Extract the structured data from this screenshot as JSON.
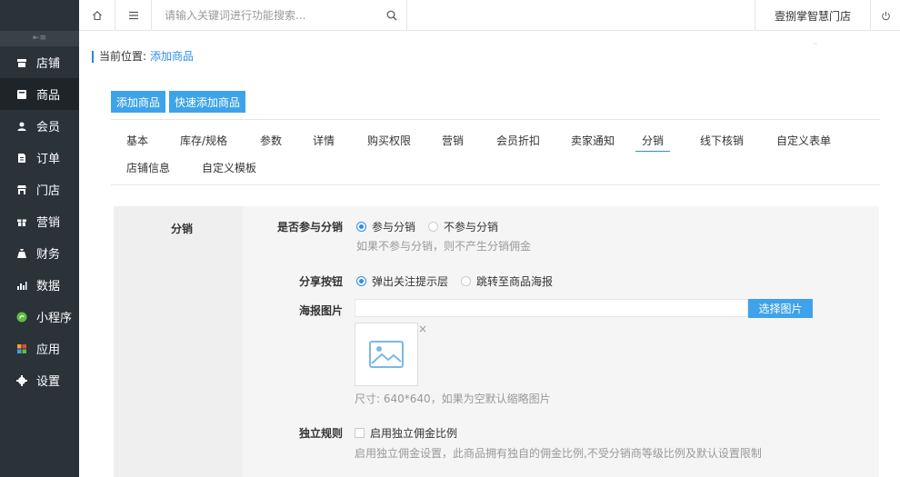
{
  "sidebar": {
    "collapse_icon": "collapse-icon",
    "items": [
      {
        "label": "店铺",
        "icon": "store-icon",
        "active": false
      },
      {
        "label": "商品",
        "icon": "goods-icon",
        "active": true
      },
      {
        "label": "会员",
        "icon": "member-icon",
        "active": false
      },
      {
        "label": "订单",
        "icon": "order-icon",
        "active": false
      },
      {
        "label": "门店",
        "icon": "shop-icon",
        "active": false
      },
      {
        "label": "营销",
        "icon": "gift-icon",
        "active": false
      },
      {
        "label": "财务",
        "icon": "finance-icon",
        "active": false
      },
      {
        "label": "数据",
        "icon": "chart-icon",
        "active": false
      },
      {
        "label": "小程序",
        "icon": "miniapp-icon",
        "active": false
      },
      {
        "label": "应用",
        "icon": "apps-icon",
        "active": false
      },
      {
        "label": "设置",
        "icon": "gear-icon",
        "active": false
      }
    ]
  },
  "topbar": {
    "search_placeholder": "请输入关键词进行功能搜索...",
    "store_name": "壹捌掌智慧门店"
  },
  "breadcrumb": {
    "label": "当前位置:",
    "current": "添加商品"
  },
  "buttons": {
    "add": "添加商品",
    "quick_add": "快速添加商品"
  },
  "tabs": [
    {
      "label": "基本"
    },
    {
      "label": "库存/规格"
    },
    {
      "label": "参数"
    },
    {
      "label": "详情"
    },
    {
      "label": "购买权限"
    },
    {
      "label": "营销"
    },
    {
      "label": "会员折扣"
    },
    {
      "label": "卖家通知"
    },
    {
      "label": "分销",
      "active": true
    },
    {
      "label": "线下核销"
    },
    {
      "label": "自定义表单"
    },
    {
      "label": "店铺信息"
    },
    {
      "label": "自定义模板"
    }
  ],
  "form": {
    "section_title": "分销",
    "participate": {
      "label": "是否参与分销",
      "option_yes": "参与分销",
      "option_no": "不参与分销",
      "selected": "参与分销",
      "hint": "如果不参与分销，则不产生分销佣金"
    },
    "share_button": {
      "label": "分享按钮",
      "option_popup": "弹出关注提示层",
      "option_poster": "跳转至商品海报",
      "selected": "弹出关注提示层"
    },
    "poster_image": {
      "label": "海报图片",
      "value": "",
      "pick_label": "选择图片",
      "close_symbol": "×",
      "hint": "尺寸: 640*640，如果为空默认缩略图片"
    },
    "independent_rule": {
      "label": "独立规则",
      "checkbox_label": "启用独立佣金比例",
      "checked": false,
      "hint": "启用独立佣金设置，此商品拥有独自的佣金比例,不受分销商等级比例及默认设置限制"
    }
  }
}
